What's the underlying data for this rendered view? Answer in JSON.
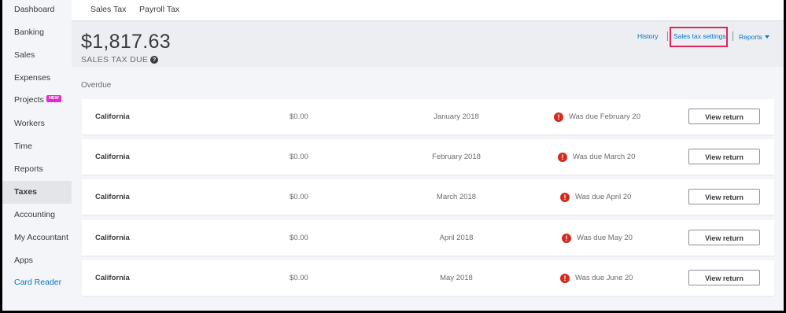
{
  "sidebar": {
    "items": [
      {
        "label": "Dashboard"
      },
      {
        "label": "Banking"
      },
      {
        "label": "Sales"
      },
      {
        "label": "Expenses"
      },
      {
        "label": "Projects",
        "badge": "NEW"
      },
      {
        "label": "Workers"
      },
      {
        "label": "Time"
      },
      {
        "label": "Reports"
      },
      {
        "label": "Taxes",
        "active": true
      },
      {
        "label": "Accounting"
      },
      {
        "label": "My Accountant"
      },
      {
        "label": "Apps"
      },
      {
        "label": "Card Reader",
        "link": true
      }
    ]
  },
  "tabs": [
    {
      "label": "Sales Tax"
    },
    {
      "label": "Payroll Tax"
    }
  ],
  "header": {
    "amount": "$1,817.63",
    "amount_label": "SALES TAX DUE",
    "help_icon": "?",
    "links": {
      "history": "History",
      "settings": "Sales tax settings",
      "reports": "Reports"
    }
  },
  "overdue": {
    "title": "Overdue",
    "button_label": "View return",
    "alert_icon": "!",
    "rows": [
      {
        "agency": "California",
        "amount": "$0.00",
        "period": "January 2018",
        "status": "Was due February 20"
      },
      {
        "agency": "California",
        "amount": "$0.00",
        "period": "February 2018",
        "status": "Was due March 20"
      },
      {
        "agency": "California",
        "amount": "$0.00",
        "period": "March 2018",
        "status": "Was due April 20"
      },
      {
        "agency": "California",
        "amount": "$0.00",
        "period": "April 2018",
        "status": "Was due May 20"
      },
      {
        "agency": "California",
        "amount": "$0.00",
        "period": "May 2018",
        "status": "Was due June 20"
      }
    ]
  },
  "colors": {
    "link": "#0077c5",
    "highlight": "#e2245c",
    "alert": "#d52b1e",
    "badge": "#e32ac6"
  }
}
